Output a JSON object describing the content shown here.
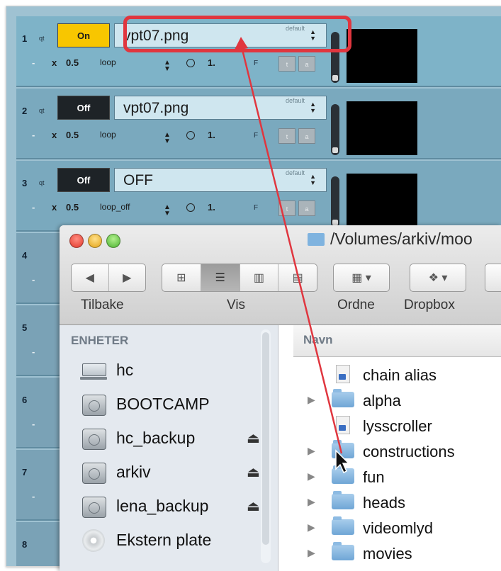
{
  "rows": [
    {
      "num": "1",
      "qt": "qt",
      "state": "On",
      "file": "vpt07.png",
      "default_label": "default",
      "dash": "-",
      "x": "x",
      "speed": "0.5",
      "mode": "loop",
      "rate": "1.",
      "f": "F",
      "t1": "t",
      "t2": "a"
    },
    {
      "num": "2",
      "qt": "qt",
      "state": "Off",
      "file": "vpt07.png",
      "default_label": "default",
      "dash": "-",
      "x": "x",
      "speed": "0.5",
      "mode": "loop",
      "rate": "1.",
      "f": "F",
      "t1": "t",
      "t2": "a"
    },
    {
      "num": "3",
      "qt": "qt",
      "state": "Off",
      "file": "OFF",
      "default_label": "default",
      "dash": "-",
      "x": "x",
      "speed": "0.5",
      "mode": "loop_off",
      "rate": "1.",
      "f": "F",
      "t1": "t",
      "t2": "a"
    }
  ],
  "hidden_rows": [
    {
      "num": "4",
      "dash": "-"
    },
    {
      "num": "5",
      "dash": "-"
    },
    {
      "num": "6",
      "dash": "-"
    },
    {
      "num": "7",
      "dash": "-"
    },
    {
      "num": "8",
      "dash": "-"
    }
  ],
  "finder": {
    "title": "/Volumes/arkiv/moo",
    "toolbar": {
      "back_label": "Tilbake",
      "view_label": "Vis",
      "arrange_label": "Ordne",
      "dropbox_label": "Dropbox"
    },
    "sidebar_heading": "ENHETER",
    "devices": [
      {
        "name": "hc",
        "icon": "laptop-icon",
        "eject": false
      },
      {
        "name": "BOOTCAMP",
        "icon": "disk-icon",
        "eject": false
      },
      {
        "name": "hc_backup",
        "icon": "disk-icon",
        "eject": true
      },
      {
        "name": "arkiv",
        "icon": "disk-icon",
        "eject": true
      },
      {
        "name": "lena_backup",
        "icon": "disk-icon",
        "eject": true
      },
      {
        "name": "Ekstern plate",
        "icon": "disc-icon",
        "eject": false
      }
    ],
    "column_header": "Navn",
    "files": [
      {
        "name": "chain alias",
        "type": "alias",
        "expandable": false
      },
      {
        "name": "alpha",
        "type": "folder",
        "expandable": true
      },
      {
        "name": "lysscroller",
        "type": "alias",
        "expandable": false
      },
      {
        "name": "constructions",
        "type": "folder",
        "expandable": true
      },
      {
        "name": "fun",
        "type": "folder",
        "expandable": true
      },
      {
        "name": "heads",
        "type": "folder",
        "expandable": true
      },
      {
        "name": "videomlyd",
        "type": "folder",
        "expandable": true
      },
      {
        "name": "movies",
        "type": "folder",
        "expandable": true
      }
    ]
  },
  "colors": {
    "highlight": "#e0363f",
    "on_toggle": "#f8c600",
    "off_toggle": "#1e2327"
  }
}
